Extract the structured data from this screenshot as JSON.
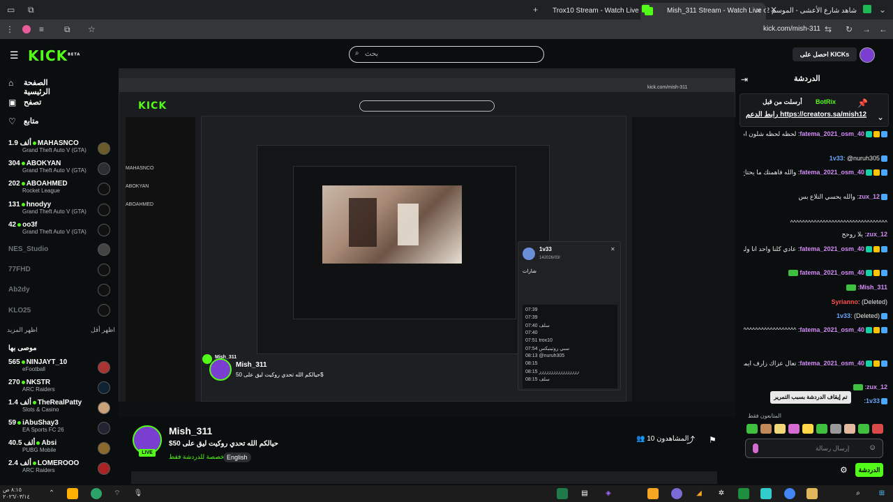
{
  "browser": {
    "tabs": [
      {
        "label": "Trox10 Stream - Watch Live on"
      },
      {
        "label": "Mish_311 Stream - Watch Live o"
      },
      {
        "label": "شاهد شارع الأعشى - الموسم 2"
      }
    ],
    "url": "kick.com/mish-311"
  },
  "header": {
    "logo": "KICK",
    "logo_beta": "BETA",
    "search_placeholder": "بحث",
    "get_kicks": "احصل على KICKs"
  },
  "sidebar": {
    "nav": [
      "الصفحة الرئيسية",
      "تصفح",
      "متابع"
    ],
    "followed": [
      {
        "name": "MAHASNCO",
        "viewers": "1.9 ألف",
        "game": "Grand Theft Auto V (GTA)",
        "live": true
      },
      {
        "name": "ABOKYAN",
        "viewers": "304",
        "game": "Grand Theft Auto V (GTA)",
        "live": true
      },
      {
        "name": "ABOAHMED",
        "viewers": "202",
        "game": "Rocket League",
        "live": true
      },
      {
        "name": "hnodyy",
        "viewers": "131",
        "game": "Grand Theft Auto V (GTA)",
        "live": true
      },
      {
        "name": "oo3f",
        "viewers": "42",
        "game": "Grand Theft Auto V (GTA)",
        "live": true
      },
      {
        "name": "NES_Studio",
        "viewers": "",
        "game": "",
        "live": false
      },
      {
        "name": "77FHD",
        "viewers": "",
        "game": "",
        "live": false
      },
      {
        "name": "Ab2dy",
        "viewers": "",
        "game": "",
        "live": false
      },
      {
        "name": "KLO25",
        "viewers": "",
        "game": "",
        "live": false
      }
    ],
    "show_more": "اظهر المزيد",
    "show_less": "اظهر أقل",
    "recommended_title": "موصى بها",
    "recommended": [
      {
        "name": "NINJAYT_10",
        "viewers": "565",
        "game": "eFootball"
      },
      {
        "name": "NKSTR",
        "viewers": "270",
        "game": "ARC Raiders"
      },
      {
        "name": "TheRealPatty",
        "viewers": "1.4 ألف",
        "game": "Slots & Casino"
      },
      {
        "name": "iAbuShay3",
        "viewers": "59",
        "game": "EA Sports FC 26"
      },
      {
        "name": "Absi",
        "viewers": "40.5 ألف",
        "game": "PUBG Mobile"
      },
      {
        "name": "LOMEROOO",
        "viewers": "2.4 ألف",
        "game": "ARC Raiders"
      }
    ]
  },
  "stream": {
    "channel": "Mish_311",
    "title": "حيالكم الله تحدي روكيت ليق على 50$",
    "tag_followers_only": "مخصصة للدردشة فقط",
    "tag_language": "English",
    "live_badge": "LIVE",
    "viewers_label": "المشاهدون",
    "viewers_count": "10"
  },
  "popup": {
    "user": "1v33",
    "date": "142026/03/",
    "badges_title": "شارات",
    "times": [
      "07:39",
      "07:39",
      "07:40",
      "07:40",
      "07:51",
      "07:54",
      "08:13",
      "08:15",
      "08:15",
      "08:15"
    ],
    "lines": [
      "",
      "",
      "سلف",
      "",
      "trox10",
      "سبي روتينيكس",
      "@nuruh305",
      "",
      "ززززززززززززززززز",
      "سلف"
    ]
  },
  "chat": {
    "title": "الدردشة",
    "pinned_by_label": "أرسلت من قبل",
    "pinned_user": "BotRix",
    "pinned_text": "رابط الدعم https://creators.sa/mish12",
    "messages": [
      {
        "user": "fatema_2021_osm_40",
        "text": "لحظه لحظه شلون ام ما احب بنتها ما تجي ذي"
      },
      {
        "user": "1v33",
        "text": "@nuruh305"
      },
      {
        "user": "fatema_2021_osm_40",
        "text": "والله فاهمتك ما يحتاج اشرح"
      },
      {
        "user": "zux_12",
        "text": "والله يحسي التلاع بس"
      },
      {
        "user": "",
        "text": "^^^^^^^^^^^^^^^^^^^^^^^^^^^^^^^^^"
      },
      {
        "user": "zux_12",
        "text": "يلا روحح"
      },
      {
        "user": "fatema_2021_osm_40",
        "text": "عادي كلنا واحد انا ولوره"
      },
      {
        "user": "fatema_2021_osm_40",
        "text": ""
      },
      {
        "user": "Mish_311",
        "text": ""
      },
      {
        "user": "Syrianno",
        "text": "(Deleted)"
      },
      {
        "user": "1v33",
        "text": "(Deleted)"
      },
      {
        "user": "fatema_2021_osm_40",
        "text": "^^^^^^^^^^^^^^^^^^^^^^^^^^^^^^^^^"
      },
      {
        "user": "fatema_2021_osm_40",
        "text": "تعال عزاك زارف ايموتي"
      },
      {
        "user": "zux_12",
        "text": ""
      },
      {
        "user": "1v33",
        "text": ""
      }
    ],
    "pause_notice": "تم إيقاف الدردشة بسبب التمرير",
    "followers_label": "المتابعون فقط",
    "input_placeholder": "إرسال رسالة",
    "send_label": "الدردشة"
  },
  "taskbar": {
    "time": "٨:١٥ ص",
    "date": "٢٠٢٦/٠٣/١٤"
  }
}
